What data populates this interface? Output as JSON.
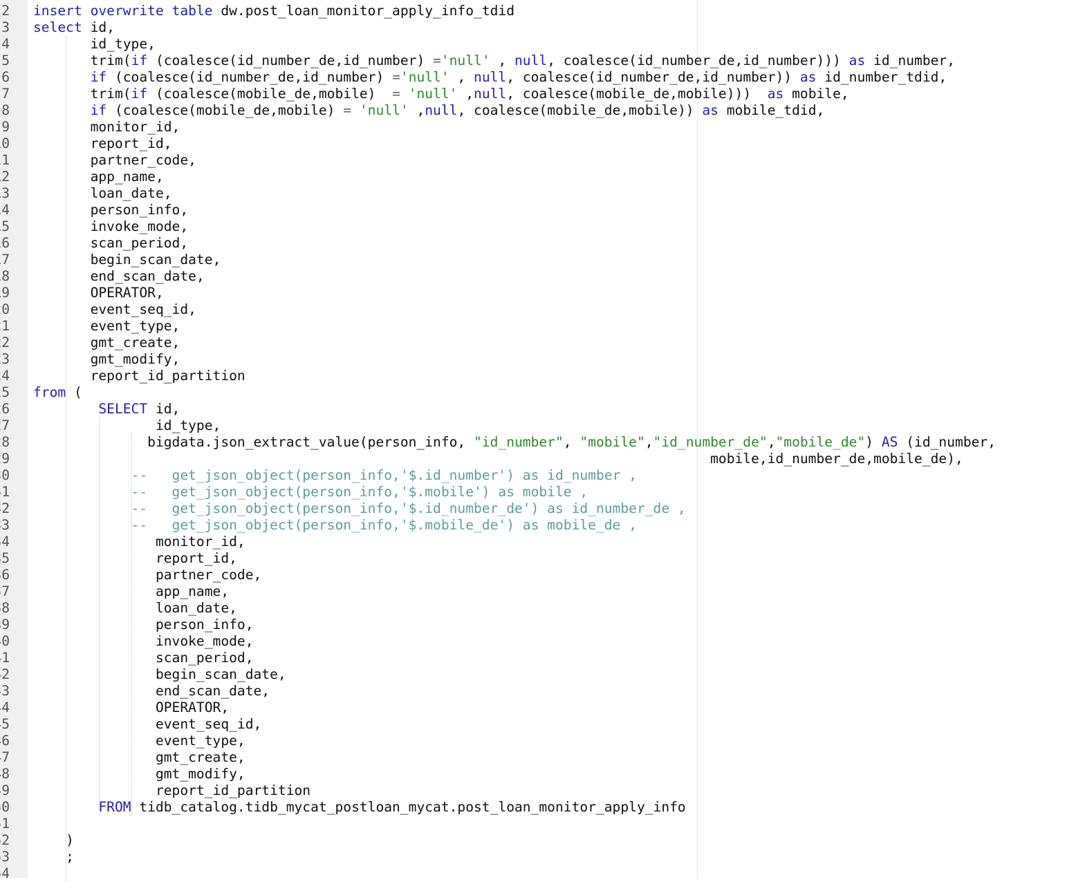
{
  "editor": {
    "first_line_number": 1,
    "lines": [
      [],
      [
        [
          "kw",
          "insert overwrite table"
        ],
        [
          "p",
          " dw.post_loan_monitor_apply_info_tdid"
        ]
      ],
      [
        [
          "kw",
          "select"
        ],
        [
          "p",
          " id,"
        ]
      ],
      [
        [
          "p",
          "       id_type,"
        ]
      ],
      [
        [
          "p",
          "       trim("
        ],
        [
          "kw",
          "if"
        ],
        [
          "p",
          " (coalesce(id_number_de,id_number) "
        ],
        [
          "op",
          "="
        ],
        [
          "str",
          "'null'"
        ],
        [
          "p",
          " , "
        ],
        [
          "kw",
          "null"
        ],
        [
          "p",
          ", coalesce(id_number_de,id_number))) "
        ],
        [
          "kw",
          "as"
        ],
        [
          "p",
          " id_number,"
        ]
      ],
      [
        [
          "p",
          "       "
        ],
        [
          "kw",
          "if"
        ],
        [
          "p",
          " (coalesce(id_number_de,id_number) "
        ],
        [
          "op",
          "="
        ],
        [
          "str",
          "'null'"
        ],
        [
          "p",
          " , "
        ],
        [
          "kw",
          "null"
        ],
        [
          "p",
          ", coalesce(id_number_de,id_number)) "
        ],
        [
          "kw",
          "as"
        ],
        [
          "p",
          " id_number_tdid,"
        ]
      ],
      [
        [
          "p",
          "       trim("
        ],
        [
          "kw",
          "if"
        ],
        [
          "p",
          " (coalesce(mobile_de,mobile)  "
        ],
        [
          "op",
          "="
        ],
        [
          "p",
          " "
        ],
        [
          "str",
          "'null'"
        ],
        [
          "p",
          " ,"
        ],
        [
          "kw",
          "null"
        ],
        [
          "p",
          ", coalesce(mobile_de,mobile)))  "
        ],
        [
          "kw",
          "as"
        ],
        [
          "p",
          " mobile,"
        ]
      ],
      [
        [
          "p",
          "       "
        ],
        [
          "kw",
          "if"
        ],
        [
          "p",
          " (coalesce(mobile_de,mobile) "
        ],
        [
          "op",
          "="
        ],
        [
          "p",
          " "
        ],
        [
          "str",
          "'null'"
        ],
        [
          "p",
          " ,"
        ],
        [
          "kw",
          "null"
        ],
        [
          "p",
          ", coalesce(mobile_de,mobile)) "
        ],
        [
          "kw",
          "as"
        ],
        [
          "p",
          " mobile_tdid,"
        ]
      ],
      [
        [
          "p",
          "       monitor_id,"
        ]
      ],
      [
        [
          "p",
          "       report_id,"
        ]
      ],
      [
        [
          "p",
          "       partner_code,"
        ]
      ],
      [
        [
          "p",
          "       app_name,"
        ]
      ],
      [
        [
          "p",
          "       loan_date,"
        ]
      ],
      [
        [
          "p",
          "       person_info,"
        ]
      ],
      [
        [
          "p",
          "       invoke_mode,"
        ]
      ],
      [
        [
          "p",
          "       scan_period,"
        ]
      ],
      [
        [
          "p",
          "       begin_scan_date,"
        ]
      ],
      [
        [
          "p",
          "       end_scan_date,"
        ]
      ],
      [
        [
          "p",
          "       OPERATOR,"
        ]
      ],
      [
        [
          "p",
          "       event_seq_id,"
        ]
      ],
      [
        [
          "p",
          "       event_type,"
        ]
      ],
      [
        [
          "p",
          "       gmt_create,"
        ]
      ],
      [
        [
          "p",
          "       gmt_modify,"
        ]
      ],
      [
        [
          "p",
          "       report_id_partition"
        ]
      ],
      [
        [
          "kw",
          "from"
        ],
        [
          "p",
          " ("
        ]
      ],
      [
        [
          "p",
          "        "
        ],
        [
          "kw",
          "SELECT"
        ],
        [
          "p",
          " id,"
        ]
      ],
      [
        [
          "p",
          "               id_type,"
        ]
      ],
      [
        [
          "p",
          "              bigdata.json_extract_value(person_info, "
        ],
        [
          "str",
          "\"id_number\""
        ],
        [
          "p",
          ", "
        ],
        [
          "str",
          "\"mobile\""
        ],
        [
          "p",
          ","
        ],
        [
          "str",
          "\"id_number_de\""
        ],
        [
          "p",
          ","
        ],
        [
          "str",
          "\"mobile_de\""
        ],
        [
          "p",
          ") "
        ],
        [
          "kw",
          "AS"
        ],
        [
          "p",
          " (id_number,"
        ]
      ],
      [
        [
          "p",
          "                                                                                   mobile,id_number_de,mobile_de),"
        ]
      ],
      [
        [
          "p",
          "            "
        ],
        [
          "cm",
          "--   get_json_object(person_info,'$.id_number') as id_number ,"
        ]
      ],
      [
        [
          "p",
          "            "
        ],
        [
          "cm",
          "--   get_json_object(person_info,'$.mobile') as mobile ,"
        ]
      ],
      [
        [
          "p",
          "            "
        ],
        [
          "cm",
          "--   get_json_object(person_info,'$.id_number_de') as id_number_de ,"
        ]
      ],
      [
        [
          "p",
          "            "
        ],
        [
          "cm",
          "--   get_json_object(person_info,'$.mobile_de') as mobile_de ,"
        ]
      ],
      [
        [
          "p",
          "               monitor_id,"
        ]
      ],
      [
        [
          "p",
          "               report_id,"
        ]
      ],
      [
        [
          "p",
          "               partner_code,"
        ]
      ],
      [
        [
          "p",
          "               app_name,"
        ]
      ],
      [
        [
          "p",
          "               loan_date,"
        ]
      ],
      [
        [
          "p",
          "               person_info,"
        ]
      ],
      [
        [
          "p",
          "               invoke_mode,"
        ]
      ],
      [
        [
          "p",
          "               scan_period,"
        ]
      ],
      [
        [
          "p",
          "               begin_scan_date,"
        ]
      ],
      [
        [
          "p",
          "               end_scan_date,"
        ]
      ],
      [
        [
          "p",
          "               OPERATOR,"
        ]
      ],
      [
        [
          "p",
          "               event_seq_id,"
        ]
      ],
      [
        [
          "p",
          "               event_type,"
        ]
      ],
      [
        [
          "p",
          "               gmt_create,"
        ]
      ],
      [
        [
          "p",
          "               gmt_modify,"
        ]
      ],
      [
        [
          "p",
          "               report_id_partition"
        ]
      ],
      [
        [
          "p",
          "        "
        ],
        [
          "kw",
          "FROM"
        ],
        [
          "p",
          " tidb_catalog.tidb_mycat_postloan_mycat.post_loan_monitor_apply_info"
        ]
      ],
      [],
      [
        [
          "p",
          "    )"
        ]
      ],
      [
        [
          "p",
          "    ;"
        ]
      ],
      []
    ]
  }
}
